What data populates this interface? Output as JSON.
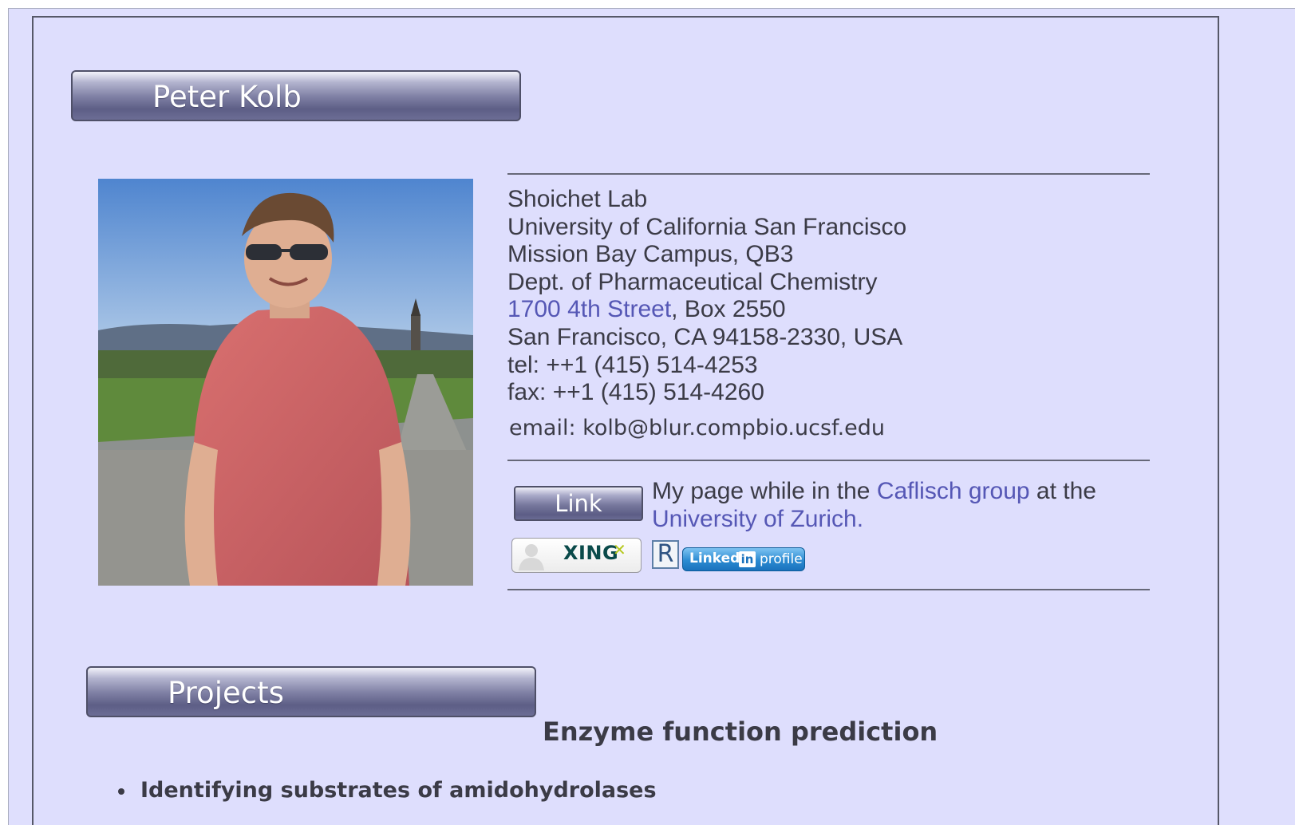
{
  "header": {
    "name": "Peter Kolb"
  },
  "contact": {
    "lab": "Shoichet Lab",
    "university": "University of California San Francisco",
    "campus": "Mission Bay Campus, QB3",
    "department": "Dept. of Pharmaceutical Chemistry",
    "street_link": "1700 4th Street",
    "box": ", Box 2550",
    "city": "San Francisco, CA 94158-2330, USA",
    "tel": "tel: ++1 (415) 514-4253",
    "fax": "fax: ++1 (415) 514-4260",
    "email": "email: kolb@blur.compbio.ucsf.edu"
  },
  "links": {
    "link_button": "Link",
    "text_before": "My page while in the ",
    "caflisch_link": "Caflisch group",
    "text_middle": " at the ",
    "zurich_link": "University of Zurich",
    "text_end": "."
  },
  "badges": {
    "xing": "XING",
    "researchgate": "R",
    "linkedin_name": "Linked",
    "linkedin_in": "in",
    "linkedin_profile": "profile"
  },
  "projects": {
    "section_title": "Projects",
    "heading": "Enzyme function prediction",
    "items": [
      "Identifying substrates of amidohydrolases"
    ]
  },
  "colors": {
    "page_background": "#dedefd",
    "link": "#5557b5",
    "text": "#3b3b46",
    "bar_dark": "#5d5e86"
  }
}
